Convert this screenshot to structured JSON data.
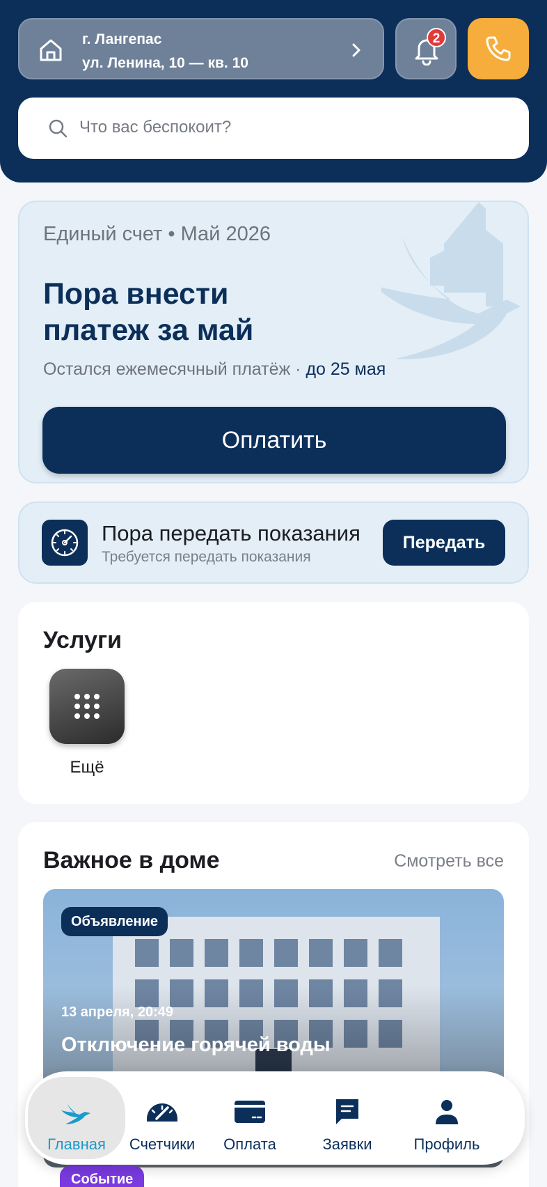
{
  "header": {
    "city": "г. Лангепас",
    "street": "ул. Ленина, 10 — кв. 10",
    "notifications_count": "2",
    "search_placeholder": "Что вас беспокоит?"
  },
  "bill": {
    "subtitle": "Единый счет • Май 2026",
    "title": "Пора внести платеж за май",
    "note": "Остался ежемесячный платёж ·",
    "due": "до 25 мая",
    "pay_label": "Оплатить"
  },
  "meters": {
    "title": "Пора передать показания",
    "subtitle": "Требуется передать показания",
    "button_label": "Передать"
  },
  "services": {
    "title": "Услуги",
    "items": [
      {
        "label": "Ещё",
        "icon": "grid-dots-icon"
      }
    ]
  },
  "important": {
    "title": "Важное в доме",
    "see_all": "Смотреть все",
    "news": [
      {
        "tag": "Объявление",
        "date": "13 апреля, 20:49",
        "title": "Отключение горячей воды"
      },
      {
        "tag": "Событие"
      }
    ]
  },
  "tabbar": {
    "items": [
      {
        "label": "Главная",
        "icon": "swallow-icon",
        "active": true
      },
      {
        "label": "Счетчики",
        "icon": "gauge-icon"
      },
      {
        "label": "Оплата",
        "icon": "card-icon"
      },
      {
        "label": "Заявки",
        "icon": "chat-icon"
      },
      {
        "label": "Профиль",
        "icon": "person-icon"
      }
    ]
  },
  "colors": {
    "primary": "#0c2f5a",
    "accent": "#f6ad3c",
    "active_tab": "#1d9ac9",
    "badge": "#e23a3a"
  }
}
